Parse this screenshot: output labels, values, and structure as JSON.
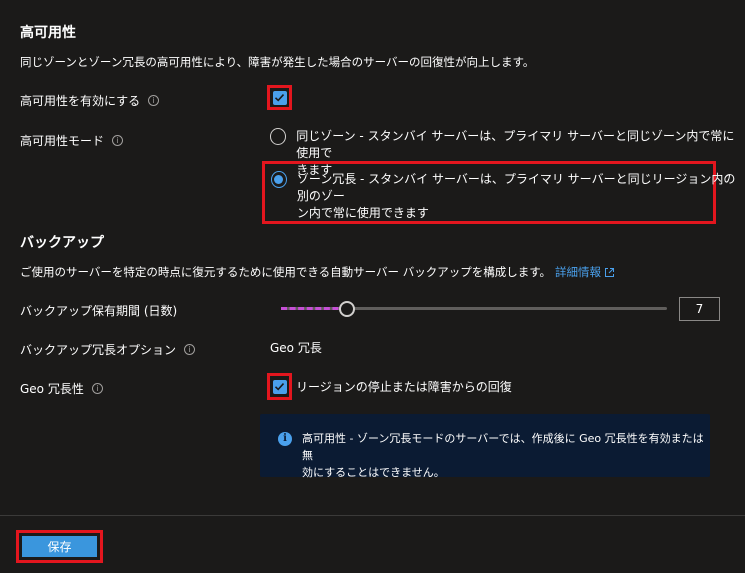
{
  "ha": {
    "title": "高可用性",
    "description": "同じゾーンとゾーン冗長の高可用性により、障害が発生した場合のサーバーの回復性が向上します。",
    "enable_label": "高可用性を有効にする",
    "enable_checked": true,
    "mode_label": "高可用性モード",
    "modes": [
      {
        "line1": "同じゾーン - スタンバイ サーバーは、プライマリ サーバーと同じゾーン内で常に使用で",
        "line2": "きます",
        "selected": false
      },
      {
        "line1": "ゾーン冗長 - スタンバイ サーバーは、プライマリ サーバーと同じリージョン内の別のゾー",
        "line2": "ン内で常に使用できます",
        "selected": true
      }
    ]
  },
  "backup": {
    "title": "バックアップ",
    "description": "ご使用のサーバーを特定の時点に復元するために使用できる自動サーバー バックアップを構成します。",
    "link_text": "詳細情報",
    "retention_label": "バックアップ保有期間 (日数)",
    "retention_value": "7",
    "retention_fraction": 0.17,
    "redundancy_label": "バックアップ冗長オプション",
    "redundancy_value": "Geo 冗長",
    "geo_label": "Geo 冗長性",
    "geo_checkbox_label": "リージョンの停止または障害からの回復",
    "geo_checked": true,
    "info_line1": "高可用性 - ゾーン冗長モードのサーバーでは、作成後に Geo 冗長性を有効または無",
    "info_line2": "効にすることはできません。"
  },
  "footer": {
    "save_label": "保存"
  },
  "colors": {
    "background": "#1b1a19",
    "accent": "#4aa0ec",
    "highlight_box": "#e3161e",
    "slider_fill": "#c64fd6",
    "info_background": "#0b1b33"
  },
  "icons": [
    "info-icon",
    "checkmark-icon",
    "external-link-icon",
    "info-circle-icon"
  ]
}
